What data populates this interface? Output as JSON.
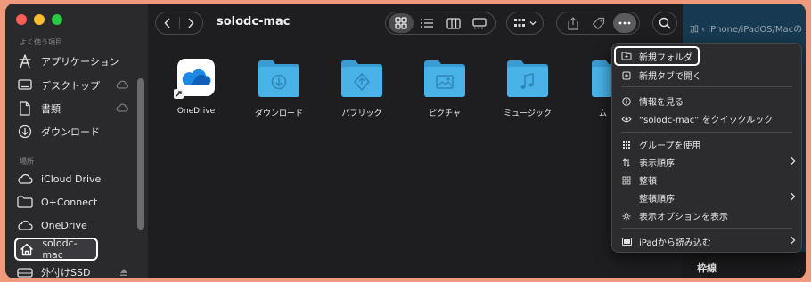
{
  "window": {
    "title": "solodc-mac"
  },
  "sidebar": {
    "section_favorites": "よく使う項目",
    "favorites": [
      {
        "label": "アプリケーション",
        "icon": "applications-icon"
      },
      {
        "label": "デスクトップ",
        "icon": "desktop-icon",
        "cloud": true
      },
      {
        "label": "書類",
        "icon": "document-icon",
        "cloud": true
      },
      {
        "label": "ダウンロード",
        "icon": "download-icon"
      }
    ],
    "section_locations": "場所",
    "locations": [
      {
        "label": "iCloud Drive",
        "icon": "cloud-icon"
      },
      {
        "label": "O+Connect",
        "icon": "folder-icon"
      },
      {
        "label": "OneDrive",
        "icon": "cloud-icon"
      },
      {
        "label": "solodc-mac",
        "icon": "home-icon",
        "selected": true
      },
      {
        "label": "外付けSSD",
        "icon": "external-drive-icon"
      }
    ]
  },
  "toolbar": {
    "back": "‹",
    "forward": "›",
    "view_modes": [
      "icon-view",
      "list-view",
      "column-view",
      "gallery-view"
    ],
    "active_view": "icon-view"
  },
  "files": [
    {
      "name": "OneDrive",
      "type": "onedrive-app"
    },
    {
      "name": "ダウンロード",
      "type": "folder",
      "glyph": "download"
    },
    {
      "name": "パブリック",
      "type": "folder",
      "glyph": "public"
    },
    {
      "name": "ピクチャ",
      "type": "folder",
      "glyph": "picture"
    },
    {
      "name": "ミュージック",
      "type": "folder",
      "glyph": "music"
    },
    {
      "name": "ム",
      "type": "folder",
      "glyph": "movie"
    }
  ],
  "menu": {
    "items": [
      {
        "label": "新規フォルダ",
        "icon": "new-folder-icon",
        "highlight": true
      },
      {
        "label": "新規タブで開く",
        "icon": "new-tab-icon"
      },
      {
        "separator": true
      },
      {
        "label": "情報を見る",
        "icon": "info-icon"
      },
      {
        "label": "“solodc-mac” をクイックルック",
        "icon": "eye-icon"
      },
      {
        "separator": true
      },
      {
        "label": "グループを使用",
        "icon": "group-icon"
      },
      {
        "label": "表示順序",
        "icon": "sort-icon",
        "submenu": true
      },
      {
        "label": "整頓",
        "icon": "grid-icon"
      },
      {
        "label": "整頓順序",
        "icon": "",
        "submenu": true
      },
      {
        "label": "表示オプションを表示",
        "icon": "settings-icon"
      },
      {
        "separator": true
      },
      {
        "label": "iPadから読み込む",
        "icon": "ipad-icon",
        "submenu": true
      }
    ]
  },
  "background": {
    "tab_text": "加 ‹ iPhone/iPadOS/Macの",
    "bottom_label": "枠線"
  },
  "colors": {
    "folder": "#49b3e8",
    "folder_dark": "#3a9cd2",
    "accent_border": "#ffffff",
    "outer_bg": "#ef9a7c"
  }
}
